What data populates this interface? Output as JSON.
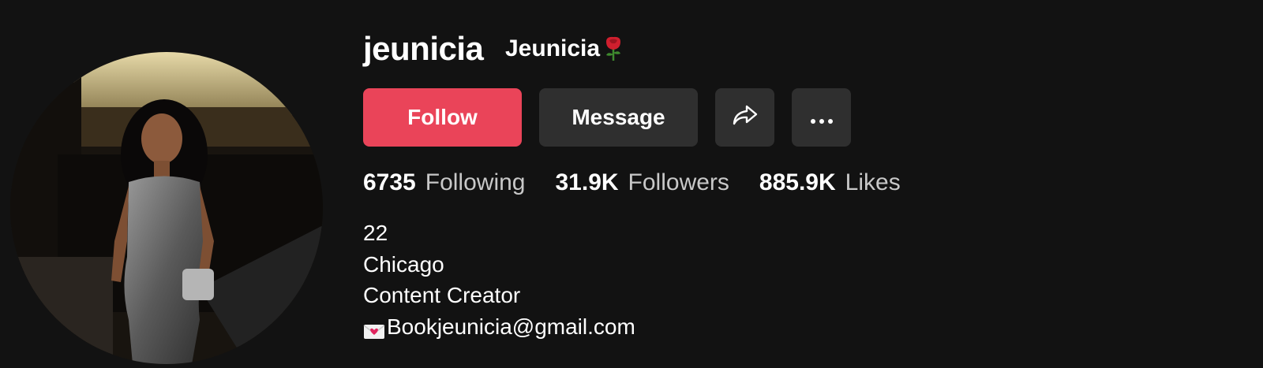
{
  "profile": {
    "username": "jeunicia",
    "nickname": "Jeunicia",
    "nickname_emoji": "rose-icon",
    "avatar_alt": "profile photo"
  },
  "actions": {
    "follow_label": "Follow",
    "message_label": "Message",
    "share_icon": "share-icon",
    "more_icon": "more-icon"
  },
  "stats": [
    {
      "value": "6735",
      "label": "Following"
    },
    {
      "value": "31.9K",
      "label": "Followers"
    },
    {
      "value": "885.9K",
      "label": "Likes"
    }
  ],
  "bio": {
    "lines": [
      "22",
      "Chicago",
      "Content Creator"
    ],
    "email_emoji": "envelope-icon",
    "email": "Bookjeunicia@gmail.com"
  },
  "colors": {
    "background": "#121212",
    "follow_button": "#ea4459",
    "secondary_button": "#2f2f2f",
    "stat_label": "#c8c8c8"
  }
}
